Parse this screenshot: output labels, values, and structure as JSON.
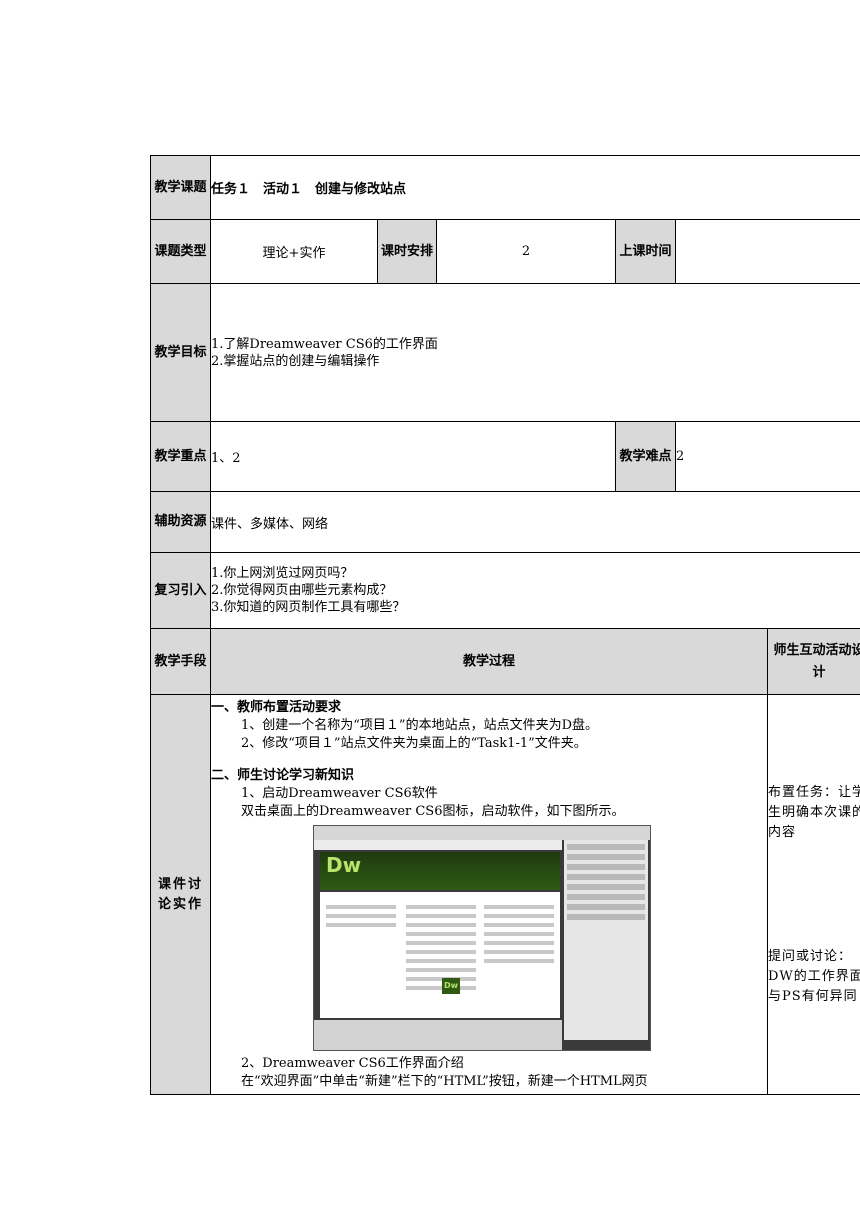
{
  "rows": {
    "topic": {
      "label": "教学课题",
      "value": "任务１　活动１　创建与修改站点"
    },
    "type": {
      "label": "课题类型",
      "value": "理论+实作",
      "hours_label": "课时安排",
      "hours_value": "2",
      "time_label": "上课时间",
      "time_value": ""
    },
    "goals": {
      "label": "教学目标",
      "items": [
        "1.了解Dreamweaver CS6的工作界面",
        "2.掌握站点的创建与编辑操作"
      ]
    },
    "key": {
      "label": "教学重点",
      "value": "1、2",
      "difficult_label": "教学难点",
      "difficult_value": "2"
    },
    "resources": {
      "label": "辅助资源",
      "value": "课件、多媒体、网络"
    },
    "review": {
      "label": "复习引入",
      "items": [
        "1.你上网浏览过网页吗？",
        "2.你觉得网页由哪些元素构成？",
        "3.你知道的网页制作工具有哪些？"
      ]
    },
    "process_header": {
      "label": "教学手段",
      "center": "教学过程",
      "right": "师生互动活动设计"
    }
  },
  "process": {
    "method": "课件讨论实作",
    "sec1_title": "一、教师布置活动要求",
    "sec1_items": [
      "1、创建一个名称为“项目１”的本地站点，站点文件夹为D盘。",
      "2、修改“项目１”站点文件夹为桌面上的“Task1-1”文件夹。"
    ],
    "sec2_title": "二、师生讨论学习新知识",
    "sec2_item1": "1、启动Dreamweaver CS6软件",
    "sec2_item1_desc": "双击桌面上的Dreamweaver CS6图标，启动软件，如下图所示。",
    "screenshot_logo": "Dw",
    "screenshot_badge": "Dw",
    "sec2_item2": "2、Dreamweaver CS6工作界面介绍",
    "sec2_item2_desc": "在“欢迎界面”中单击“新建”栏下的“HTML”按钮，新建一个HTML网页",
    "note1": "布置任务：让学生明确本次课的内容",
    "note2": "提问或讨论：DW的工作界面与PS有何异同"
  }
}
